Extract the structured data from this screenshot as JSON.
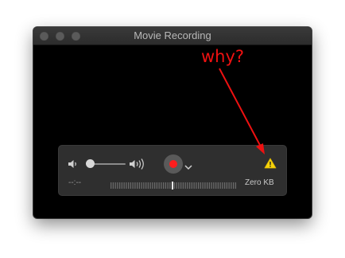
{
  "window": {
    "title": "Movie Recording"
  },
  "controls": {
    "time_display": "--:--",
    "file_size": "Zero KB",
    "record_button_color": "#ff1d1d",
    "volume_low_icon": "speaker-low-icon",
    "volume_high_icon": "speaker-high-icon",
    "options_icon": "chevron-down-icon",
    "warning_icon": "warning-triangle-icon",
    "volume_level": 0
  },
  "annotation": {
    "text": "why?",
    "color": "#ee1111"
  }
}
